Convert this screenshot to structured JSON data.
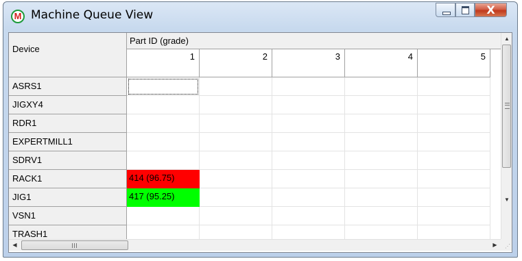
{
  "window": {
    "title": "Machine Queue View",
    "icon": "machine-m-icon",
    "icon_letter": "M",
    "controls": {
      "minimize": "minimize-icon",
      "maximize": "maximize-icon",
      "close": "close-icon",
      "close_glyph": "X"
    }
  },
  "grid": {
    "device_header": "Device",
    "part_header": "Part ID (grade)",
    "columns": [
      "1",
      "2",
      "3",
      "4",
      "5"
    ],
    "rows": [
      {
        "device": "ASRS1",
        "cells": [
          "",
          "",
          "",
          "",
          ""
        ]
      },
      {
        "device": "JIGXY4",
        "cells": [
          "",
          "",
          "",
          "",
          ""
        ]
      },
      {
        "device": "RDR1",
        "cells": [
          "",
          "",
          "",
          "",
          ""
        ]
      },
      {
        "device": "EXPERTMILL1",
        "cells": [
          "",
          "",
          "",
          "",
          ""
        ]
      },
      {
        "device": "SDRV1",
        "cells": [
          "",
          "",
          "",
          "",
          ""
        ]
      },
      {
        "device": "RACK1",
        "cells": [
          "414 (96.75)",
          "",
          "",
          "",
          ""
        ]
      },
      {
        "device": "JIG1",
        "cells": [
          "417 (95.25)",
          "",
          "",
          "",
          ""
        ]
      },
      {
        "device": "VSN1",
        "cells": [
          "",
          "",
          "",
          "",
          ""
        ]
      },
      {
        "device": "TRASH1",
        "cells": [
          "",
          "",
          "",
          "",
          ""
        ]
      }
    ],
    "focused_cell": {
      "row": 0,
      "col": 0
    },
    "cell_colors": {
      "414 (96.75)": "#ff0000",
      "417 (95.25)": "#00ff00"
    }
  },
  "scrollbars": {
    "vertical": {
      "up": "arrow-up-icon",
      "down": "arrow-down-icon",
      "grip": "grip-icon"
    },
    "horizontal": {
      "left": "arrow-left-icon",
      "right": "arrow-right-icon",
      "grip": "grip-icon"
    }
  }
}
